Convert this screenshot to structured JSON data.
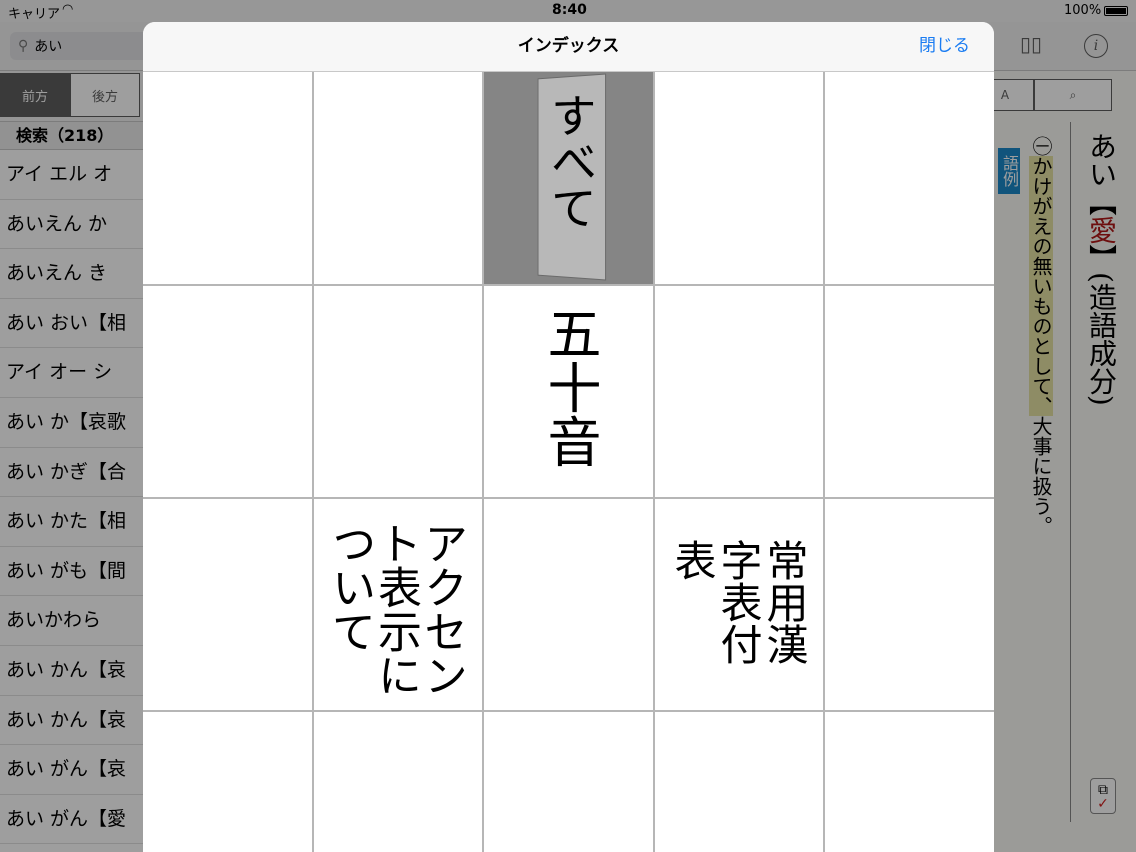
{
  "status_bar": {
    "carrier": "キャリア",
    "time": "8:40",
    "battery": "100%"
  },
  "search": {
    "query": "あい"
  },
  "filter_tabs": [
    "前方",
    "後方"
  ],
  "results": {
    "header": "検索（218）",
    "items": [
      "アイ エル オ",
      "あいえん か",
      "あいえん き",
      "あい おい【相",
      "アイ オー シ",
      "あい か【哀歌",
      "あい かぎ【合",
      "あい かた【相",
      "あい がも【間",
      "あいかわら",
      "あい かん【哀",
      "あい かん【哀",
      "あい がん【哀",
      "あい がん【愛"
    ]
  },
  "entry": {
    "headword_prefix": "あい",
    "headword_bracket_open": "【",
    "headword_kanji": "愛",
    "headword_bracket_close": "】",
    "headword_suffix": "(造語成分)",
    "definition_marker": "㊀",
    "definition_highlight": "かけがえの無いものとして、",
    "definition_rest": "大事に扱う。",
    "tag": "語例"
  },
  "modal": {
    "title": "インデックス",
    "close_label": "閉じる",
    "items": {
      "all": "すべて",
      "gojuon": "五十音",
      "accent": "アクセント表示について",
      "joyo": "常用漢字表付表"
    }
  },
  "colors": {
    "accent_blue": "#1a7cf2",
    "selected_cell": "#858585",
    "highlight": "#e6e2a3",
    "headword_kanji": "#b01818",
    "tag_blue": "#1a88c8"
  }
}
